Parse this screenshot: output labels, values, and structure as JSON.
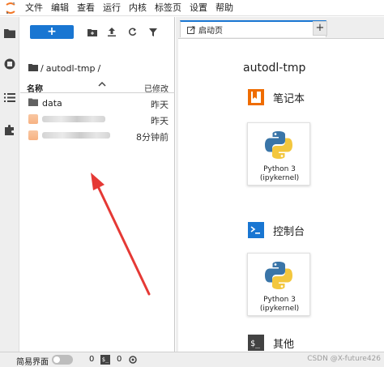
{
  "menubar": {
    "items": [
      "文件",
      "编辑",
      "查看",
      "运行",
      "内核",
      "标签页",
      "设置",
      "帮助"
    ]
  },
  "activitybar": {
    "icons": [
      "folder-icon",
      "running-icon",
      "toc-icon",
      "extension-icon"
    ]
  },
  "filebrowser": {
    "new_label": "+",
    "breadcrumb": {
      "root": "/",
      "folder": "autodl-tmp",
      "trail": "/"
    },
    "columns": {
      "name": "名称",
      "modified": "已修改"
    },
    "files": [
      {
        "name": "data",
        "type": "folder",
        "modified": "昨天"
      },
      {
        "name": "",
        "type": "file-redacted",
        "modified": "昨天"
      },
      {
        "name": "",
        "type": "file-redacted",
        "modified": "8分钟前"
      }
    ]
  },
  "tabs": {
    "active_label": "启动页",
    "close": "✕",
    "add": "+"
  },
  "launcher": {
    "cwd": "autodl-tmp",
    "sections": {
      "notebook": "笔记本",
      "console": "控制台",
      "other": "其他"
    },
    "notebook_card": {
      "line1": "Python 3",
      "line2": "(ipykernel)"
    },
    "console_card": {
      "line1": "Python 3",
      "line2": "(ipykernel)"
    }
  },
  "statusbar": {
    "simple_mode": "简易界面",
    "terminals": "0",
    "kernels": "0",
    "watermark": "CSDN @X-future426"
  },
  "colors": {
    "accent": "#1976d2",
    "notebook_icon": "#ef6c00",
    "console_icon": "#1976d2",
    "other_icon": "#424242",
    "arrow": "#e53935"
  }
}
